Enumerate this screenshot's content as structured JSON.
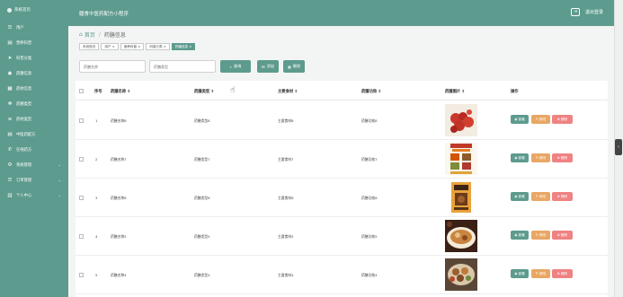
{
  "sidebar": {
    "brand": "系统首页",
    "items": [
      {
        "label": "用户",
        "icon": "user-icon",
        "glyph": "☰"
      },
      {
        "label": "营养科普",
        "icon": "book-icon",
        "glyph": "▤"
      },
      {
        "label": "科普分类",
        "icon": "send-icon",
        "glyph": "➤"
      },
      {
        "label": "药膳信息",
        "icon": "person-icon",
        "glyph": "◉"
      },
      {
        "label": "药材信息",
        "icon": "grid-icon",
        "glyph": "▦"
      },
      {
        "label": "药膳类型",
        "icon": "settings-icon",
        "glyph": "✻"
      },
      {
        "label": "药材类型",
        "icon": "bars-icon",
        "glyph": "≡"
      },
      {
        "label": "中医药配方",
        "icon": "document-icon",
        "glyph": "▤"
      },
      {
        "label": "在线药方",
        "icon": "phone-icon",
        "glyph": "✆"
      },
      {
        "label": "系统管理",
        "icon": "gear-icon",
        "glyph": "⚙",
        "expand": "⌄"
      },
      {
        "label": "订单管理",
        "icon": "list-icon",
        "glyph": "☰",
        "expand": "⌄"
      },
      {
        "label": "个人中心",
        "icon": "user-center-icon",
        "glyph": "▥",
        "expand": "⌄"
      }
    ]
  },
  "header": {
    "title": "膳食中医药配方小程序",
    "logout": "退出登录"
  },
  "breadcrumb": {
    "home": "首页",
    "separator": "/",
    "current": "药膳信息"
  },
  "tags": [
    {
      "label": "系统首页",
      "active": false
    },
    {
      "label": "用户 ×",
      "active": false
    },
    {
      "label": "营养科普 ×",
      "active": false
    },
    {
      "label": "科普分类 ×",
      "active": false
    },
    {
      "label": "药膳信息 ×",
      "active": true
    }
  ],
  "search": {
    "name_placeholder": "药膳名称",
    "type_placeholder": "药膳类型",
    "query_label": "查询",
    "add_label": "添加",
    "delete_label": "删除"
  },
  "table": {
    "headers": {
      "index": "序号",
      "name": "药膳名称 ⇕",
      "type": "药膳类型 ⇕",
      "ingredient": "主要食材 ⇕",
      "effect": "药膳功效 ⇕",
      "image": "药膳图片 ⇕",
      "action": "操作"
    },
    "rows": [
      {
        "index": "1",
        "name": "药膳名称8",
        "type": "药膳类型8",
        "ingredient": "主要食材8",
        "effect": "药膳功效8"
      },
      {
        "index": "2",
        "name": "药膳名称7",
        "type": "药膳类型7",
        "ingredient": "主要食材7",
        "effect": "药膳功效7"
      },
      {
        "index": "3",
        "name": "药膳名称6",
        "type": "药膳类型6",
        "ingredient": "主要食材6",
        "effect": "药膳功效6"
      },
      {
        "index": "4",
        "name": "药膳名称5",
        "type": "药膳类型5",
        "ingredient": "主要食材5",
        "effect": "药膳功效5"
      },
      {
        "index": "5",
        "name": "药膳名称4",
        "type": "药膳类型4",
        "ingredient": "主要食材4",
        "effect": "药膳功效4"
      }
    ],
    "actions": {
      "view": "查看",
      "edit": "修改",
      "delete": "删除"
    }
  },
  "colors": {
    "accent": "#5d9b8e",
    "edit": "#e8a765",
    "delete": "#ef8282"
  }
}
